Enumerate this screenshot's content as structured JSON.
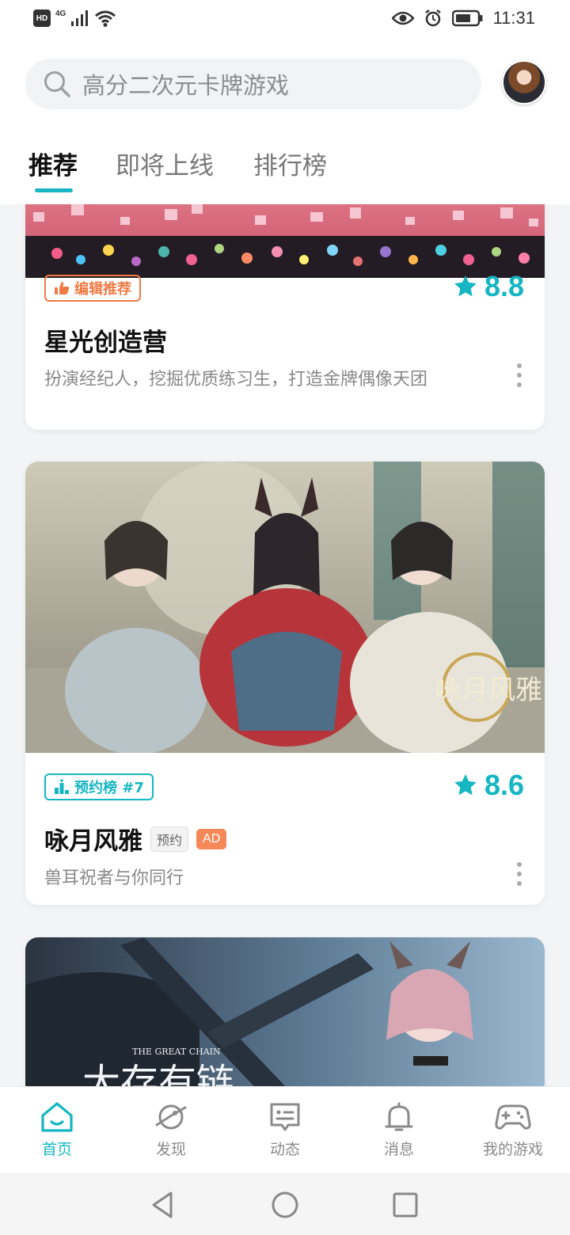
{
  "status_bar": {
    "hd": "HD",
    "network": "4G",
    "time": "11:31"
  },
  "search": {
    "placeholder": "高分二次元卡牌游戏"
  },
  "tabs": [
    {
      "label": "推荐",
      "active": true
    },
    {
      "label": "即将上线",
      "active": false
    },
    {
      "label": "排行榜",
      "active": false
    }
  ],
  "cards": [
    {
      "tag": "编辑推荐",
      "tag_icon": "thumbs-up-icon",
      "rating": "8.8",
      "title": "星光创造营",
      "desc": "扮演经纪人，挖掘优质练习生，打造金牌偶像天团"
    },
    {
      "tag": "预约榜 #7",
      "tag_icon": "ranking-icon",
      "rating": "8.6",
      "title": "咏月风雅",
      "badges": [
        "预约",
        "AD"
      ],
      "desc": "兽耳祝者与你同行",
      "image_logo": "咏月风雅"
    },
    {
      "image_caption_small": "THE GREAT CHAIN",
      "image_caption_large": "大存有链"
    }
  ],
  "bottom_nav": [
    {
      "label": "首页",
      "icon": "home-icon",
      "active": true
    },
    {
      "label": "发现",
      "icon": "planet-icon",
      "active": false
    },
    {
      "label": "动态",
      "icon": "message-card-icon",
      "active": false
    },
    {
      "label": "消息",
      "icon": "bell-icon",
      "active": false
    },
    {
      "label": "我的游戏",
      "icon": "gamepad-icon",
      "active": false
    }
  ],
  "colors": {
    "accent": "#15b6c2",
    "editor_tag": "#f07a45",
    "ad_badge": "#f48858"
  }
}
